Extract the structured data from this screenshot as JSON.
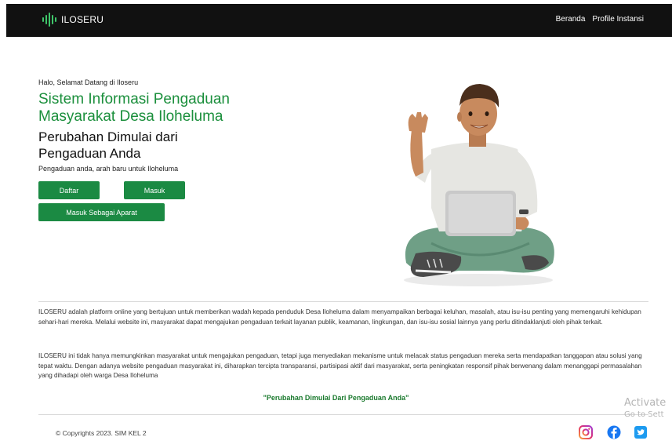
{
  "navbar": {
    "brand": "ILOSERU",
    "links": [
      "Beranda",
      "Profile Instansi"
    ]
  },
  "hero": {
    "greeting": "Halo, Selamat Datang di Iloseru",
    "title": "Sistem Informasi Pengaduan Masyarakat Desa Iloheluma",
    "subtitle": "Perubahan Dimulai dari Pengaduan Anda",
    "tagline": "Pengaduan anda, arah baru untuk Iloheluma",
    "buttons": {
      "daftar": "Daftar",
      "masuk": "Masuk",
      "aparat": "Masuk Sebagai Aparat"
    }
  },
  "about": {
    "p1": "ILOSERU adalah platform online yang bertujuan untuk memberikan wadah kepada penduduk Desa Iloheluma dalam menyampaikan berbagai keluhan, masalah, atau isu-isu penting yang memengaruhi kehidupan sehari-hari mereka. Melalui website ini, masyarakat dapat mengajukan pengaduan terkait layanan publik, keamanan, lingkungan, dan isu-isu sosial lainnya yang perlu ditindaklanjuti oleh pihak terkait.",
    "p2": "ILOSERU ini tidak hanya memungkinkan masyarakat untuk mengajukan pengaduan, tetapi juga menyediakan mekanisme untuk melacak status pengaduan mereka serta mendapatkan tanggapan atau solusi yang tepat waktu. Dengan adanya website pengaduan masyarakat ini, diharapkan tercipta transparansi, partisipasi aktif dari masyarakat, serta peningkatan responsif pihak berwenang dalam menanggapi permasalahan yang dihadapi oleh warga Desa Iloheluma",
    "quote": "\"Perubahan Dimulai Dari Pengaduan Anda\""
  },
  "footer": {
    "copyright": "© Copyrights 2023. SIM KEL 2",
    "social_icons": [
      "instagram-icon",
      "facebook-icon",
      "twitter-icon"
    ]
  },
  "watermark": {
    "line1": "Activate",
    "line2": "Go to Sett"
  },
  "colors": {
    "accent_green": "#1b8a43",
    "title_green": "#1b8f3c",
    "navbar_bg": "#111111"
  }
}
